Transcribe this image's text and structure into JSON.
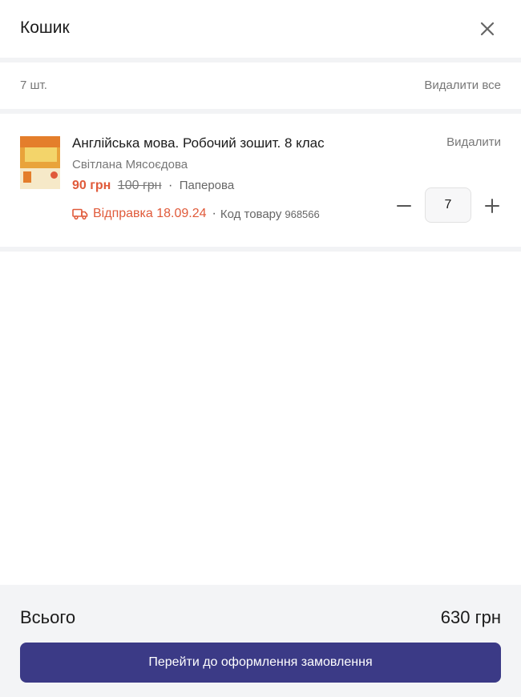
{
  "header": {
    "title": "Кошик",
    "close_icon": "close-icon"
  },
  "cart_bar": {
    "count": "7 шт.",
    "remove_all": "Видалити все"
  },
  "item": {
    "name": "Англійська мова. Робочий зошит. 8 клас",
    "author": "Світлана Мясоєдова",
    "price": "90 грн",
    "old_price": "100 грн",
    "format": "Паперова",
    "shipping": "Відправка 18.09.24",
    "code_label": "Код товару",
    "code": "968566",
    "remove": "Видалити",
    "quantity": "7",
    "separator": "·"
  },
  "footer": {
    "total_label": "Всього",
    "total_value": "630 грн",
    "checkout": "Перейти до оформлення замовлення"
  },
  "colors": {
    "accent_price": "#e05a3a",
    "checkout_bg": "#3b3a86",
    "separator": "#f2f3f5",
    "footer_bg": "#f3f4f6"
  }
}
